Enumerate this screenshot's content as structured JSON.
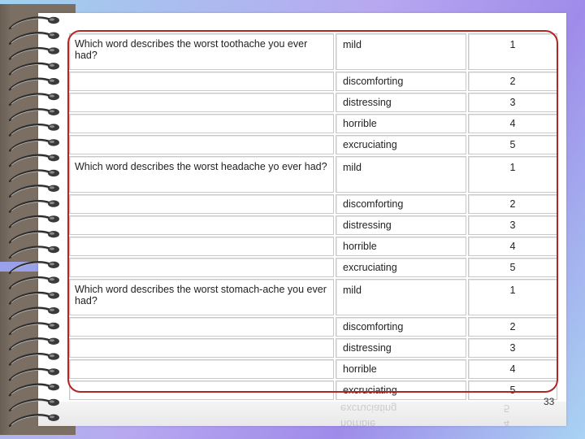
{
  "questions": [
    {
      "prompt": "Which word describes the worst toothache you ever had?",
      "options": [
        {
          "word": "mild",
          "score": "1"
        },
        {
          "word": "discomforting",
          "score": "2"
        },
        {
          "word": "distressing",
          "score": "3"
        },
        {
          "word": "horrible",
          "score": "4"
        },
        {
          "word": "excruciating",
          "score": "5"
        }
      ]
    },
    {
      "prompt": "Which word describes the worst headache yo ever had?",
      "options": [
        {
          "word": "mild",
          "score": "1"
        },
        {
          "word": "discomforting",
          "score": "2"
        },
        {
          "word": "distressing",
          "score": "3"
        },
        {
          "word": "horrible",
          "score": "4"
        },
        {
          "word": "excruciating",
          "score": "5"
        }
      ]
    },
    {
      "prompt": "Which word describes the worst stomach-ache you ever had?",
      "options": [
        {
          "word": "mild",
          "score": "1"
        },
        {
          "word": "discomforting",
          "score": "2"
        },
        {
          "word": "distressing",
          "score": "3"
        },
        {
          "word": "horrible",
          "score": "4"
        },
        {
          "word": "excruciating",
          "score": "5"
        }
      ]
    }
  ],
  "reflection": {
    "line1_word": "excruciating",
    "line1_score": "5",
    "line2_word": "horrible",
    "line2_score": "4"
  },
  "page_number": "33",
  "colors": {
    "frame": "#b32626",
    "cover": "#7b6f63"
  }
}
